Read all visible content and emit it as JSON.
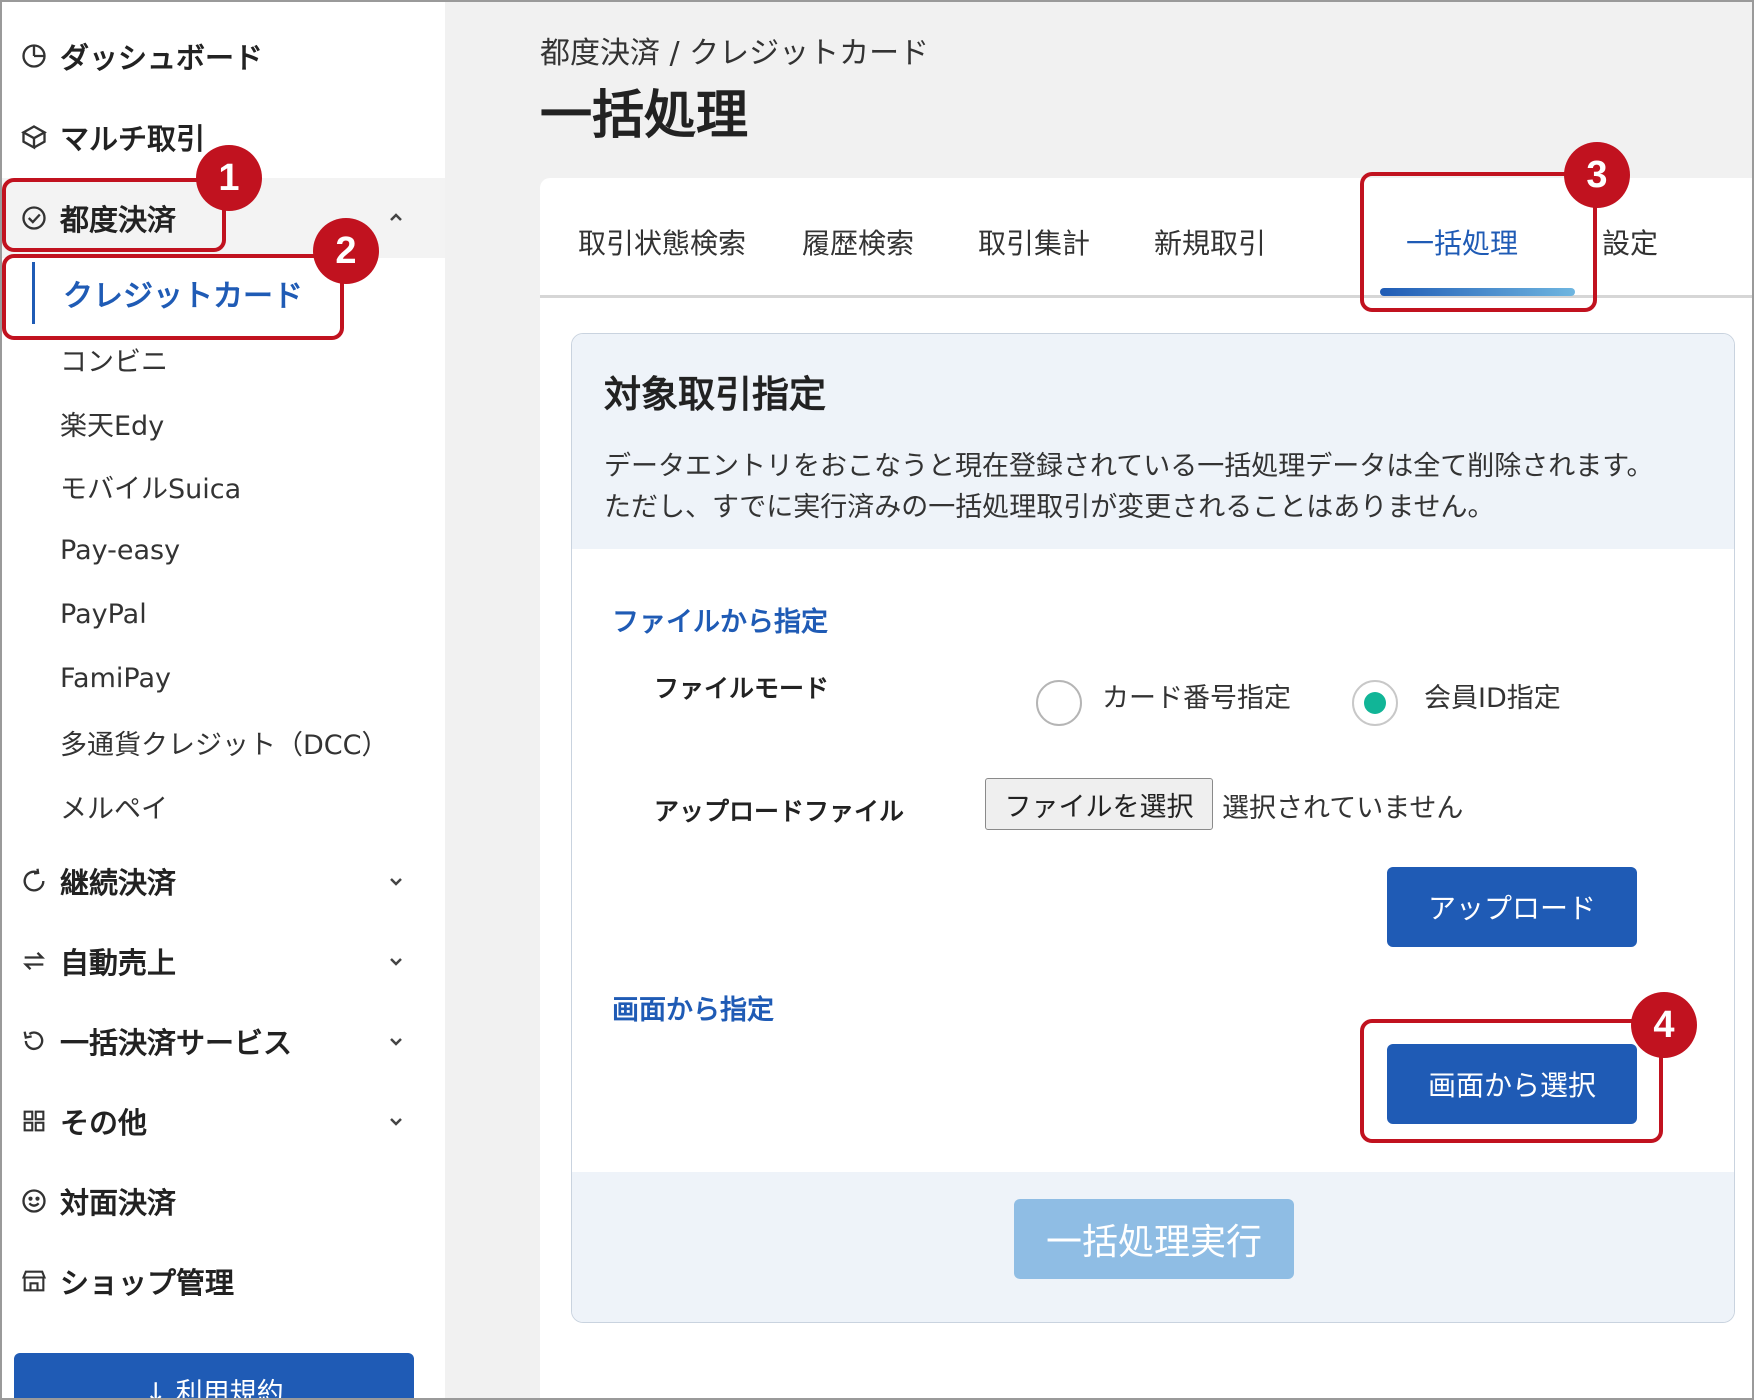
{
  "sidebar": {
    "items": [
      {
        "label": "ダッシュボード",
        "icon": "dashboard-icon"
      },
      {
        "label": "マルチ取引",
        "icon": "cube-icon"
      },
      {
        "label": "都度決済",
        "icon": "check-circle-icon"
      },
      {
        "label": "継続決済",
        "icon": "refresh-icon"
      },
      {
        "label": "自動売上",
        "icon": "swap-icon"
      },
      {
        "label": "一括決済サービス",
        "icon": "undo-icon"
      },
      {
        "label": "その他",
        "icon": "grid-icon"
      },
      {
        "label": "対面決済",
        "icon": "smile-icon"
      },
      {
        "label": "ショップ管理",
        "icon": "shop-icon"
      }
    ],
    "subitems": [
      {
        "label": "クレジットカード"
      },
      {
        "label": "コンビニ"
      },
      {
        "label": "楽天Edy"
      },
      {
        "label": "モバイルSuica"
      },
      {
        "label": "Pay-easy"
      },
      {
        "label": "PayPal"
      },
      {
        "label": "FamiPay"
      },
      {
        "label": "多通貨クレジット（DCC）"
      },
      {
        "label": "メルペイ"
      }
    ],
    "terms_label": "↓ 利用規約"
  },
  "header": {
    "breadcrumb": "都度決済 / クレジットカード",
    "title": "一括処理"
  },
  "tabs": [
    {
      "label": "取引状態検索"
    },
    {
      "label": "履歴検索"
    },
    {
      "label": "取引集計"
    },
    {
      "label": "新規取引"
    },
    {
      "label": "一括処理"
    },
    {
      "label": "設定"
    }
  ],
  "panel": {
    "title": "対象取引指定",
    "desc_line1": "データエントリをおこなうと現在登録されている一括処理データは全て削除されます。",
    "desc_line2": "ただし、すでに実行済みの一括処理取引が変更されることはありません。",
    "file_section": "ファイルから指定",
    "file_mode_label": "ファイルモード",
    "radio_card": "カード番号指定",
    "radio_member": "会員ID指定",
    "upload_file_label": "アップロードファイル",
    "choose_file": "ファイルを選択",
    "no_file": "選択されていません",
    "upload_button": "アップロード",
    "screen_section": "画面から指定",
    "select_screen_button": "画面から選択",
    "execute_button": "一括処理実行"
  },
  "callouts": [
    "1",
    "2",
    "3",
    "4"
  ],
  "colors": {
    "brand_blue": "#1f5bb5",
    "callout_red": "#c1121f",
    "radio_checked": "#11b597",
    "disabled_button": "#8fbde4"
  }
}
